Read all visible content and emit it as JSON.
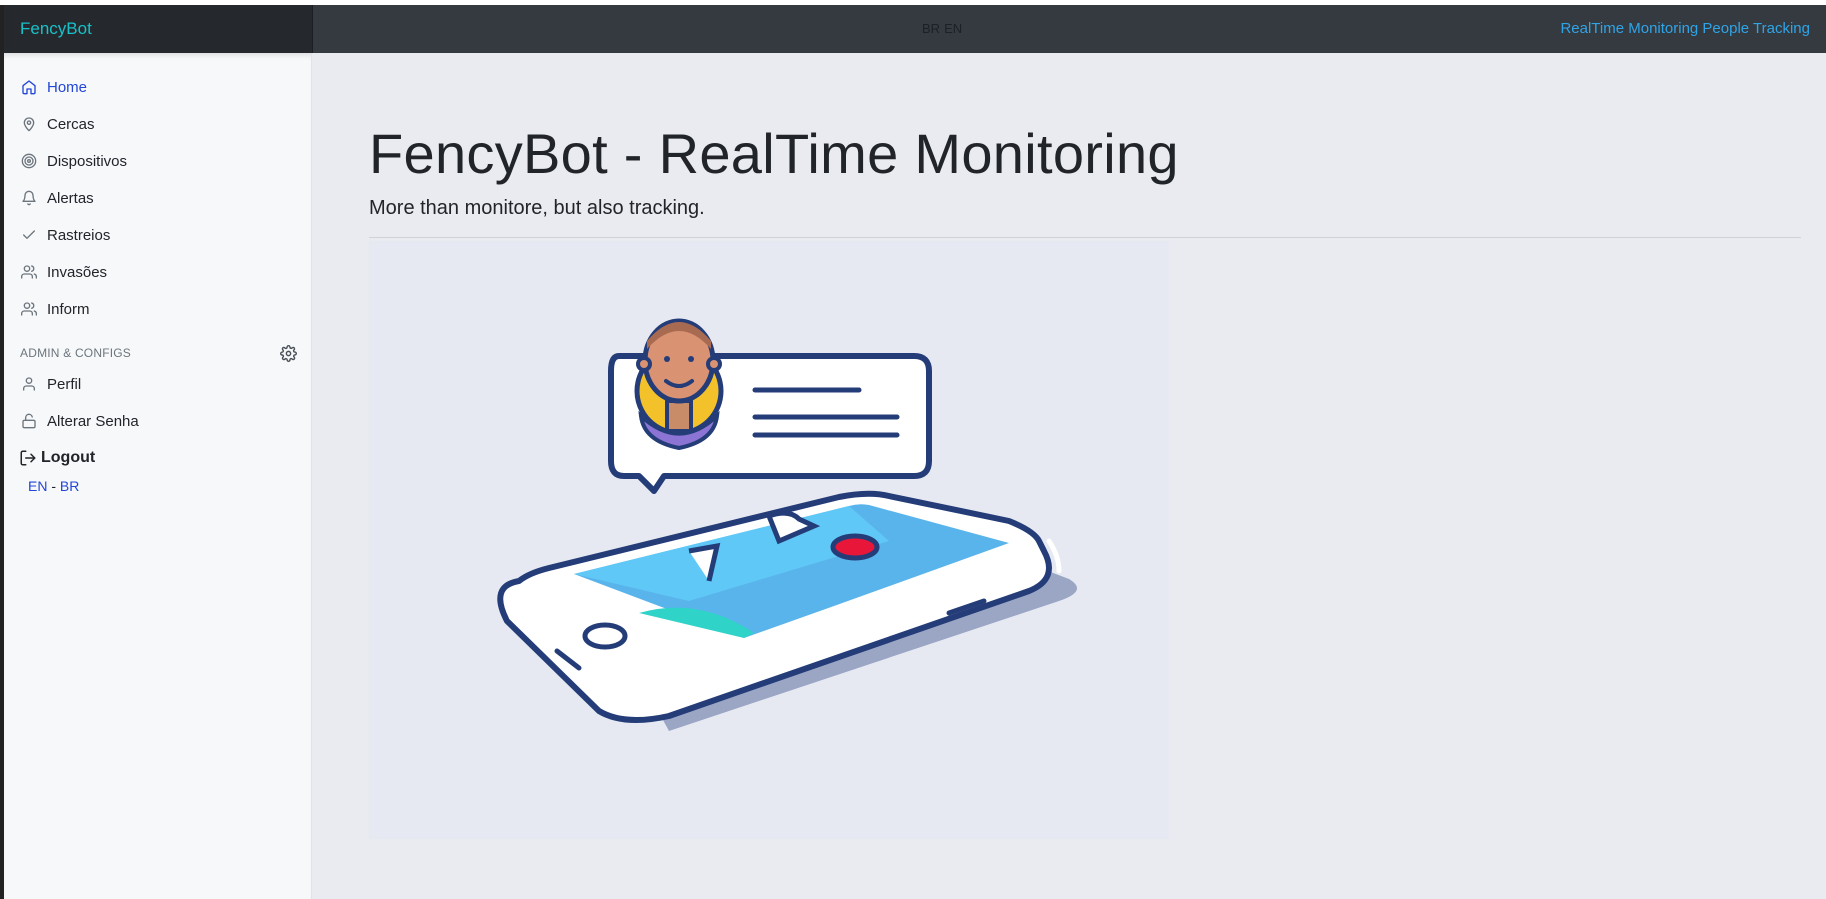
{
  "navbar": {
    "brand": "FencyBot",
    "lang_br": "BR",
    "lang_en": "EN",
    "tagline": "RealTime Monitoring People Tracking"
  },
  "sidebar": {
    "items": [
      {
        "label": "Home",
        "icon": "home-icon",
        "active": true
      },
      {
        "label": "Cercas",
        "icon": "map-pin-icon"
      },
      {
        "label": "Dispositivos",
        "icon": "target-icon"
      },
      {
        "label": "Alertas",
        "icon": "bell-icon"
      },
      {
        "label": "Rastreios",
        "icon": "check-icon"
      },
      {
        "label": "Invasões",
        "icon": "users-icon"
      },
      {
        "label": "Inform",
        "icon": "users-icon"
      }
    ],
    "admin_heading": "ADMIN & CONFIGS",
    "admin_items": [
      {
        "label": "Perfil",
        "icon": "user-icon"
      },
      {
        "label": "Alterar Senha",
        "icon": "lock-icon"
      }
    ],
    "logout": "Logout",
    "lang_en": "EN",
    "lang_sep": "-",
    "lang_br": "BR"
  },
  "main": {
    "title": "FencyBot - RealTime Monitoring",
    "subtitle": "More than monitore, but also tracking."
  },
  "colors": {
    "accent": "#2246d6",
    "brand": "#17c1c9",
    "tagline": "#2fa4e7",
    "navbar": "#343a40"
  }
}
